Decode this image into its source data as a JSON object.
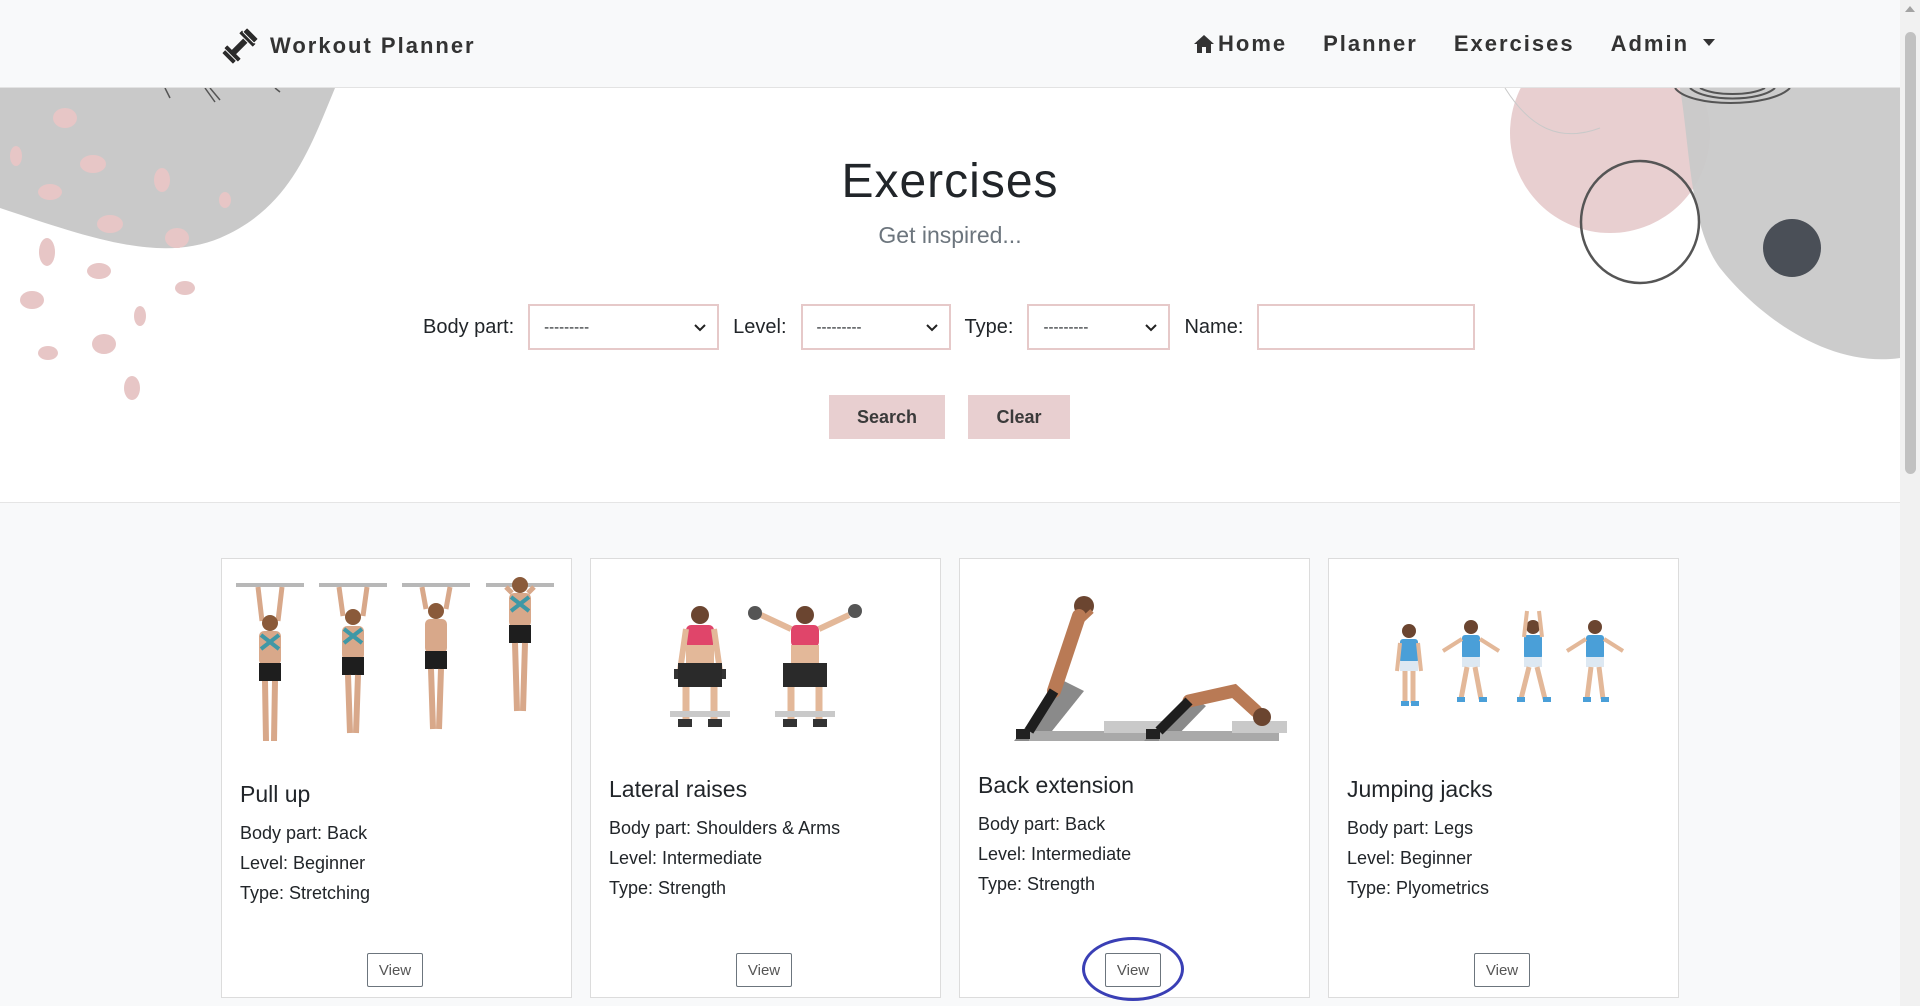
{
  "navbar": {
    "brand": "Workout Planner",
    "links": [
      {
        "label": "Home"
      },
      {
        "label": "Planner"
      },
      {
        "label": "Exercises"
      },
      {
        "label": "Admin"
      }
    ]
  },
  "hero": {
    "title": "Exercises",
    "subtitle": "Get inspired..."
  },
  "filters": {
    "body_part_label": "Body part:",
    "body_part_value": "---------",
    "level_label": "Level:",
    "level_value": "---------",
    "type_label": "Type:",
    "type_value": "---------",
    "name_label": "Name:",
    "name_value": ""
  },
  "buttons": {
    "search": "Search",
    "clear": "Clear"
  },
  "cards": [
    {
      "title": "Pull up",
      "body_part": "Body part: Back",
      "level": "Level: Beginner",
      "type": "Type: Stretching",
      "view": "View"
    },
    {
      "title": "Lateral raises",
      "body_part": "Body part: Shoulders & Arms",
      "level": "Level: Intermediate",
      "type": "Type: Strength",
      "view": "View"
    },
    {
      "title": "Back extension",
      "body_part": "Body part: Back",
      "level": "Level: Intermediate",
      "type": "Type: Strength",
      "view": "View"
    },
    {
      "title": "Jumping jacks",
      "body_part": "Body part: Legs",
      "level": "Level: Beginner",
      "type": "Type: Plyometrics",
      "view": "View"
    }
  ],
  "colors": {
    "accent_pink": "#e8cfd0",
    "highlight_ring": "#3a3fb5",
    "navbar_bg": "#f8f9fa"
  }
}
